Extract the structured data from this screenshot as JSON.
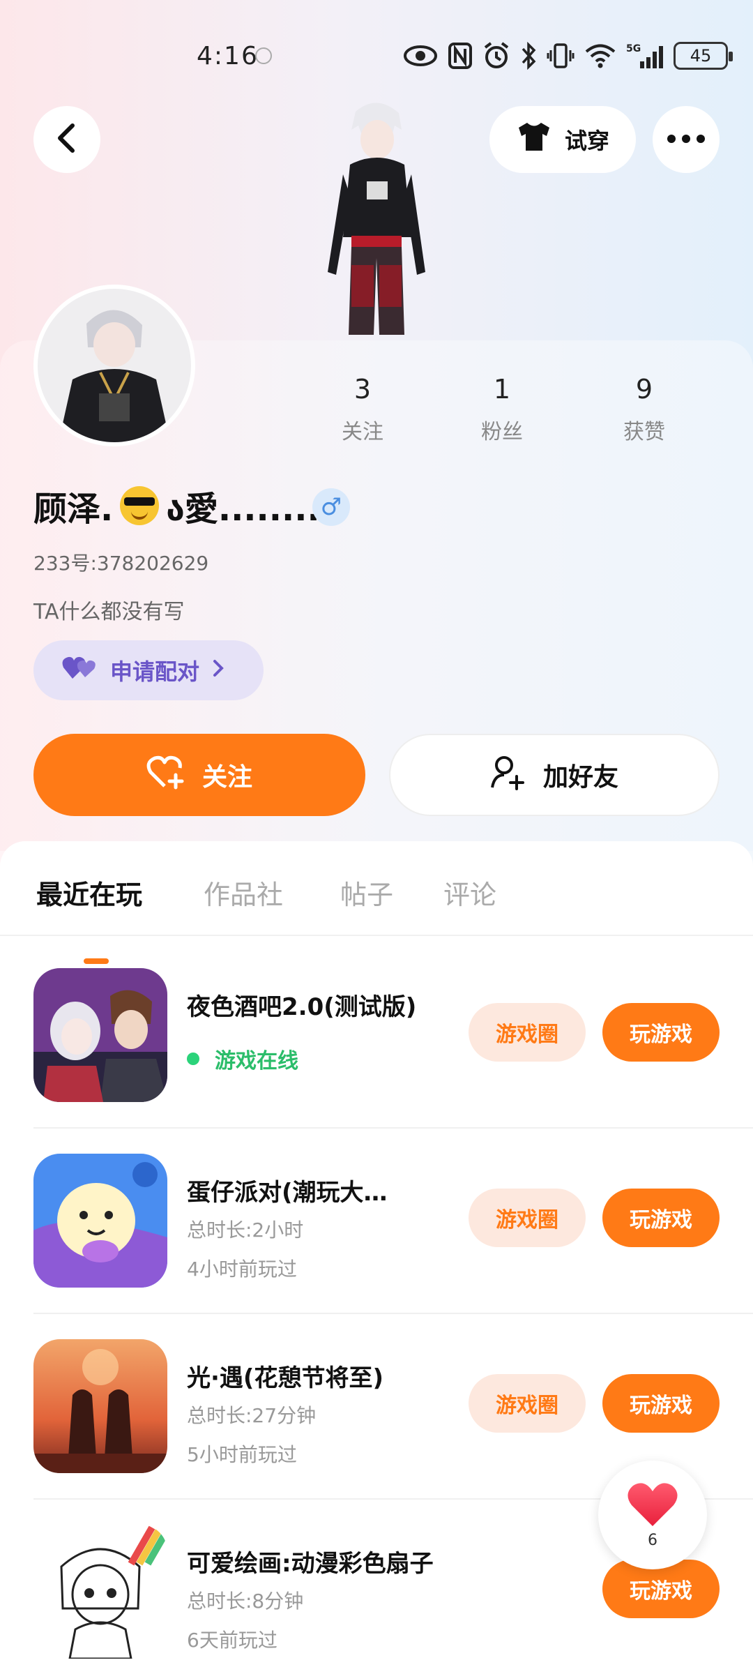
{
  "status_bar": {
    "time": "4:16",
    "battery": "45",
    "network": "5G"
  },
  "header": {
    "try_on_label": "试穿"
  },
  "profile": {
    "stats": [
      {
        "value": "3",
        "label": "关注"
      },
      {
        "value": "1",
        "label": "粉丝"
      },
      {
        "value": "9",
        "label": "获赞"
      }
    ],
    "nickname_prefix": "顾泽.",
    "nickname_suffix": "ა愛.........",
    "gender_symbol": "♂",
    "id_text": "233号:378202629",
    "bio": "TA什么都没有写",
    "pair_label": "申请配对",
    "follow_label": "关注",
    "add_friend_label": "加好友"
  },
  "tabs": [
    {
      "label": "最近在玩",
      "active": true
    },
    {
      "label": "作品社",
      "active": false
    },
    {
      "label": "帖子",
      "active": false
    },
    {
      "label": "评论",
      "active": false
    }
  ],
  "games": [
    {
      "title": "夜色酒吧2.0(测试版)",
      "status": "游戏在线",
      "circle_label": "游戏圈",
      "play_label": "玩游戏"
    },
    {
      "title": "蛋仔派对(潮玩大…",
      "duration": "总时长:2小时",
      "last_played": "4小时前玩过",
      "circle_label": "游戏圈",
      "play_label": "玩游戏"
    },
    {
      "title": "光·遇(花憩节将至)",
      "duration": "总时长:27分钟",
      "last_played": "5小时前玩过",
      "circle_label": "游戏圈",
      "play_label": "玩游戏"
    },
    {
      "title": "可爱绘画:动漫彩色扇子",
      "duration": "总时长:8分钟",
      "last_played": "6天前玩过",
      "play_label": "玩游戏"
    }
  ],
  "like_float": {
    "count": "6"
  },
  "colors": {
    "accent": "#ff7a16",
    "online": "#2bbd6a",
    "pair_purple": "#6a55c8"
  }
}
